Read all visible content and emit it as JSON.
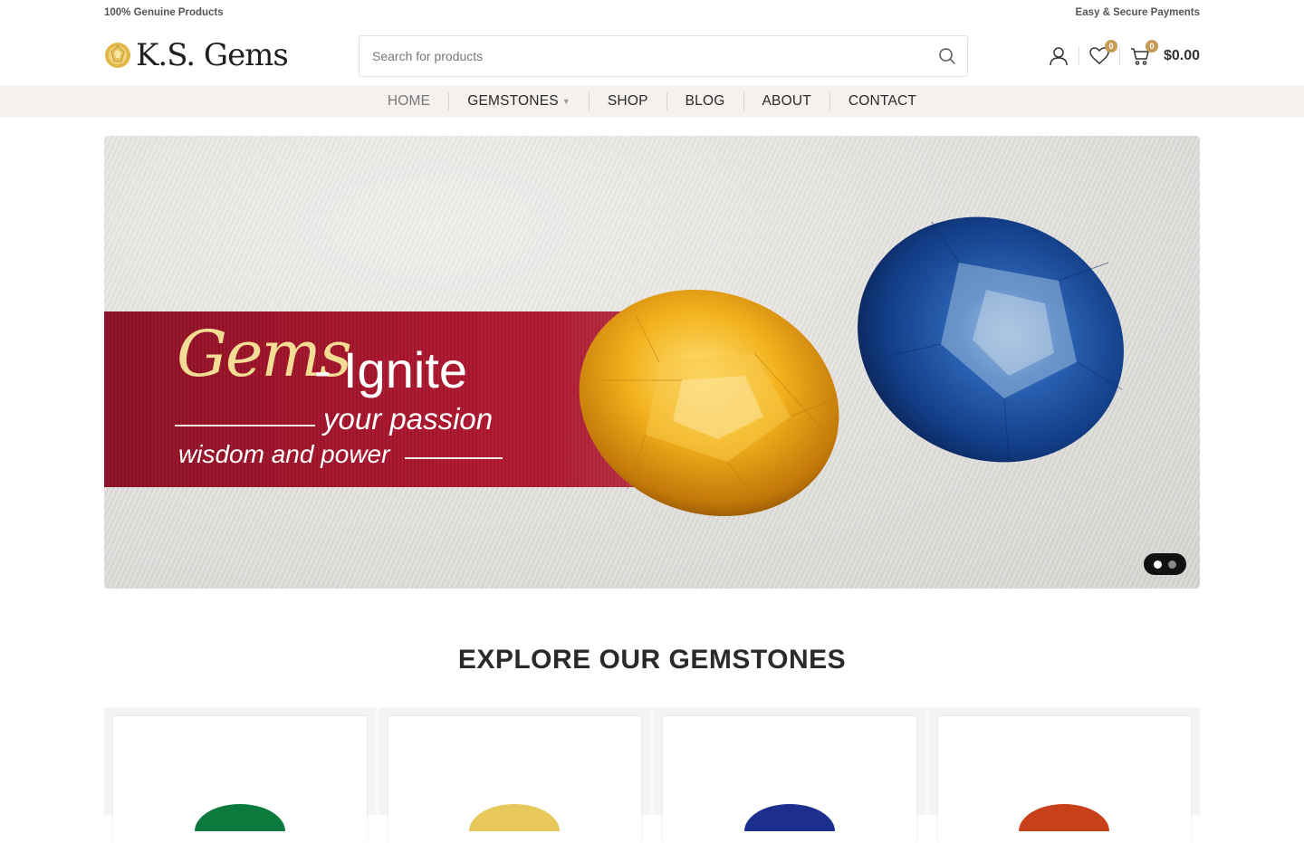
{
  "topbar": {
    "left": "100% Genuine Products",
    "right": "Easy & Secure Payments"
  },
  "header": {
    "logo_text": "K.S. Gems",
    "search_placeholder": "Search for products",
    "wishlist_count": "0",
    "cart_count": "0",
    "cart_total": "$0.00"
  },
  "nav": {
    "items": [
      "HOME",
      "GEMSTONES",
      "SHOP",
      "BLOG",
      "ABOUT",
      "CONTACT"
    ],
    "active": "HOME"
  },
  "hero": {
    "script": "Gems",
    "dash": "-",
    "word": "Ignite",
    "sub1": "your passion",
    "sub2": "wisdom and power",
    "slides_total": 2,
    "slide_active": 1
  },
  "explore": {
    "title": "EXPLORE OUR GEMSTONES"
  },
  "colors": {
    "accent": "#c89a57",
    "ribbon": "#a8142c",
    "nav_bg": "#f4f1ef",
    "stone_green": "#0d7a3d",
    "stone_yellow": "#e8c85a",
    "stone_blue": "#1c2f8f",
    "stone_red": "#c8401a"
  },
  "icons": {
    "logo": "gem-logo-icon",
    "search": "search-icon",
    "account": "user-icon",
    "wishlist": "heart-icon",
    "cart": "cart-icon"
  }
}
